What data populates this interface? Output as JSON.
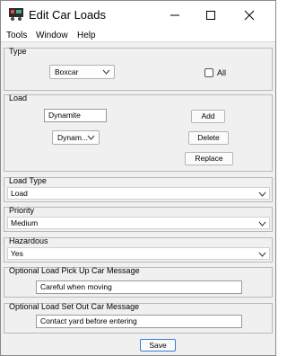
{
  "window": {
    "title": "Edit Car Loads",
    "controls": {
      "minimize": "minimize",
      "maximize": "maximize",
      "close": "close"
    }
  },
  "menu": [
    "Tools",
    "Window",
    "Help"
  ],
  "type_section": {
    "legend": "Type",
    "type_select": "Boxcar",
    "all_label": "All",
    "all_checked": false
  },
  "load_section": {
    "legend": "Load",
    "load_name_value": "Dynamite",
    "load_select": "Dynam...",
    "add_label": "Add",
    "delete_label": "Delete",
    "replace_label": "Replace"
  },
  "load_type": {
    "legend": "Load Type",
    "value": "Load"
  },
  "priority": {
    "legend": "Priority",
    "value": "Medium"
  },
  "hazardous": {
    "legend": "Hazardous",
    "value": "Yes"
  },
  "pickup_message": {
    "legend": "Optional Load Pick Up Car Message",
    "value": "Careful when moving"
  },
  "setout_message": {
    "legend": "Optional Load Set Out Car Message",
    "value": "Contact yard before entering"
  },
  "save_label": "Save"
}
